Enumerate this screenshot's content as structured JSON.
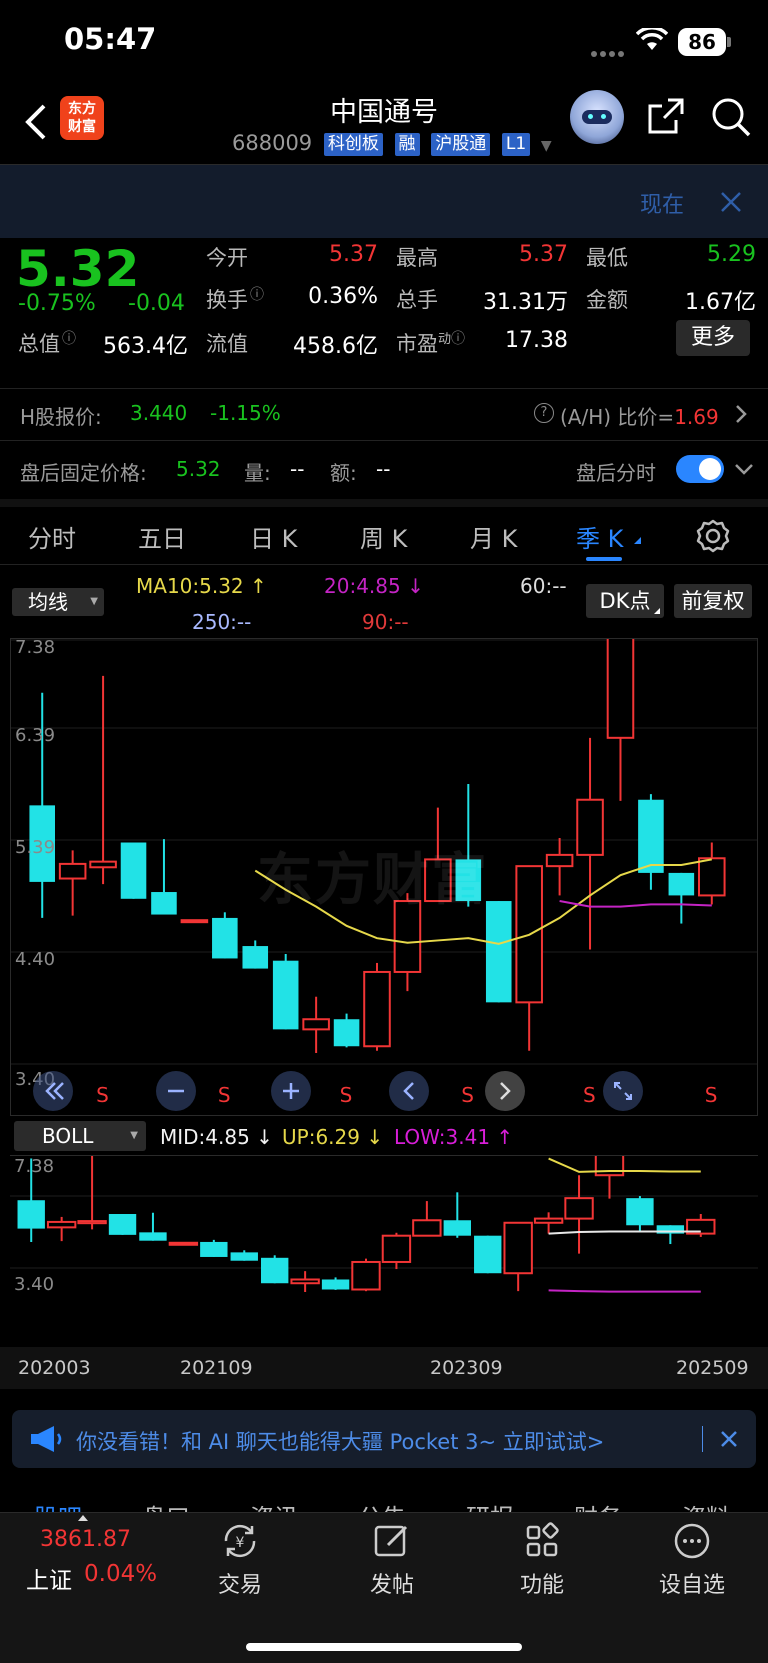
{
  "status_bar": {
    "time": "05:47",
    "battery": "86"
  },
  "header": {
    "title": "中国通号",
    "code": "688009",
    "tags": [
      "科创板",
      "融",
      "沪股通",
      "L1"
    ],
    "logo_text_1": "东方",
    "logo_text_2": "财富"
  },
  "top_banner": {
    "text": "现在"
  },
  "quote": {
    "price": "5.32",
    "change_pct": "-0.75%",
    "change": "-0.04",
    "open_label": "今开",
    "open": "5.37",
    "high_label": "最高",
    "high": "5.37",
    "low_label": "最低",
    "low": "5.29",
    "turnover_label": "换手",
    "turnover": "0.36%",
    "volume_label": "总手",
    "volume": "31.31万",
    "amount_label": "金额",
    "amount": "1.67亿",
    "mktcap_label": "总值",
    "mktcap": "563.4亿",
    "float_label": "流值",
    "float": "458.6亿",
    "pe_label": "市盈",
    "pe_sup": "动",
    "pe": "17.38",
    "more_label": "更多"
  },
  "hshare": {
    "label": "H股报价:",
    "price": "3.440",
    "change": "-1.15%",
    "ah_label": "(A/H) 比价=",
    "ah_value": "1.69"
  },
  "afterhours": {
    "label": "盘后固定价格:",
    "price": "5.32",
    "vol_label": "量:",
    "vol": "--",
    "amt_label": "额:",
    "amt": "--",
    "toggle_label": "盘后分时"
  },
  "tabs": [
    "分时",
    "五日",
    "日 K",
    "周 K",
    "月 K",
    "季 K"
  ],
  "active_tab": "季 K",
  "ma_legend": {
    "selector": "均线",
    "ma10": "MA10:5.32 ↑",
    "ma20": "20:4.85 ↓",
    "ma60": "60:--",
    "ma250": "250:--",
    "ma90": "90:--",
    "dk_button": "DK点",
    "adjust_button": "前复权"
  },
  "boll_legend": {
    "selector": "BOLL",
    "mid": "MID:4.85 ↓",
    "up": "UP:6.29 ↓",
    "low": "LOW:3.41 ↑"
  },
  "colors": {
    "up": "#f23535",
    "down": "#22e2e6",
    "ma10": "#e6d84a",
    "ma20": "#c424c4",
    "boll_mid": "#e8e8e8",
    "accent": "#2a86ff"
  },
  "chart_data": {
    "type": "candlestick",
    "main": {
      "y_ticks": [
        "7.38",
        "6.39",
        "5.39",
        "4.40",
        "3.40"
      ],
      "ylim": [
        3.4,
        7.38
      ],
      "watermark": "东方财富",
      "s_marks": [
        "S",
        "S",
        "S",
        "S",
        "S",
        "S"
      ],
      "candles": [
        {
          "o": 5.6,
          "h": 6.6,
          "l": 4.6,
          "c": 4.92
        },
        {
          "o": 4.95,
          "h": 5.2,
          "l": 4.62,
          "c": 5.08
        },
        {
          "o": 5.05,
          "h": 6.75,
          "l": 4.9,
          "c": 5.1
        },
        {
          "o": 5.27,
          "h": 5.27,
          "l": 4.77,
          "c": 4.77
        },
        {
          "o": 4.83,
          "h": 5.3,
          "l": 4.63,
          "c": 4.63
        },
        {
          "o": 4.58,
          "h": 4.58,
          "l": 4.58,
          "c": 4.58
        },
        {
          "o": 4.6,
          "h": 4.65,
          "l": 4.24,
          "c": 4.24
        },
        {
          "o": 4.35,
          "h": 4.4,
          "l": 4.15,
          "c": 4.15
        },
        {
          "o": 4.22,
          "h": 4.28,
          "l": 3.61,
          "c": 3.61
        },
        {
          "o": 3.61,
          "h": 3.9,
          "l": 3.4,
          "c": 3.7
        },
        {
          "o": 3.7,
          "h": 3.75,
          "l": 3.45,
          "c": 3.46
        },
        {
          "o": 3.46,
          "h": 4.2,
          "l": 3.42,
          "c": 4.12
        },
        {
          "o": 4.12,
          "h": 4.82,
          "l": 3.95,
          "c": 4.75
        },
        {
          "o": 4.75,
          "h": 5.58,
          "l": 4.75,
          "c": 5.12
        },
        {
          "o": 5.12,
          "h": 5.79,
          "l": 4.7,
          "c": 4.75
        },
        {
          "o": 4.75,
          "h": 4.75,
          "l": 3.85,
          "c": 3.85
        },
        {
          "o": 3.85,
          "h": 5.06,
          "l": 3.42,
          "c": 5.06
        },
        {
          "o": 5.06,
          "h": 5.31,
          "l": 4.8,
          "c": 5.16
        },
        {
          "o": 5.16,
          "h": 6.2,
          "l": 4.32,
          "c": 5.65
        },
        {
          "o": 6.2,
          "h": 7.38,
          "l": 5.64,
          "c": 7.38
        },
        {
          "o": 5.65,
          "h": 5.7,
          "l": 4.85,
          "c": 5.0
        },
        {
          "o": 5.0,
          "h": 5.0,
          "l": 4.55,
          "c": 4.8
        },
        {
          "o": 4.8,
          "h": 5.27,
          "l": 4.72,
          "c": 5.13
        }
      ],
      "ma10": [
        null,
        null,
        null,
        null,
        null,
        null,
        null,
        5.02,
        4.85,
        4.7,
        4.53,
        4.42,
        4.38,
        4.4,
        4.42,
        4.37,
        4.45,
        4.6,
        4.8,
        4.98,
        5.07,
        5.07,
        5.12
      ],
      "ma20": [
        null,
        null,
        null,
        null,
        null,
        null,
        null,
        null,
        null,
        null,
        null,
        null,
        null,
        null,
        null,
        null,
        null,
        4.75,
        4.7,
        4.7,
        4.72,
        4.72,
        4.71
      ]
    },
    "boll": {
      "y_ticks": [
        "7.38",
        "3.40"
      ],
      "ylim": [
        3.4,
        7.38
      ],
      "up": [
        null,
        null,
        null,
        null,
        null,
        null,
        null,
        null,
        null,
        null,
        null,
        null,
        null,
        null,
        null,
        null,
        null,
        6.6,
        6.28,
        6.3,
        6.3,
        6.29,
        6.29
      ],
      "mid": [
        null,
        null,
        null,
        null,
        null,
        null,
        null,
        null,
        null,
        null,
        null,
        null,
        null,
        null,
        null,
        null,
        null,
        4.8,
        4.84,
        4.85,
        4.85,
        4.85,
        4.85
      ],
      "low": [
        null,
        null,
        null,
        null,
        null,
        null,
        null,
        null,
        null,
        null,
        null,
        null,
        null,
        null,
        null,
        null,
        null,
        3.44,
        3.42,
        3.41,
        3.41,
        3.41,
        3.41
      ]
    },
    "x_ticks": [
      "202003",
      "202109",
      "202309",
      "202509"
    ]
  },
  "ad_banner": {
    "text": "你没看错！和 AI 聊天也能得大疆 Pocket 3~ 立即试试>"
  },
  "sub_tabs": [
    "股吧",
    "盘口",
    "资讯",
    "公告",
    "研报",
    "财务",
    "资料"
  ],
  "bottom_bar": {
    "index_value": "3861.87",
    "index_name": "上证",
    "index_change": "0.04%",
    "items": [
      "交易",
      "发帖",
      "功能",
      "设自选"
    ]
  }
}
